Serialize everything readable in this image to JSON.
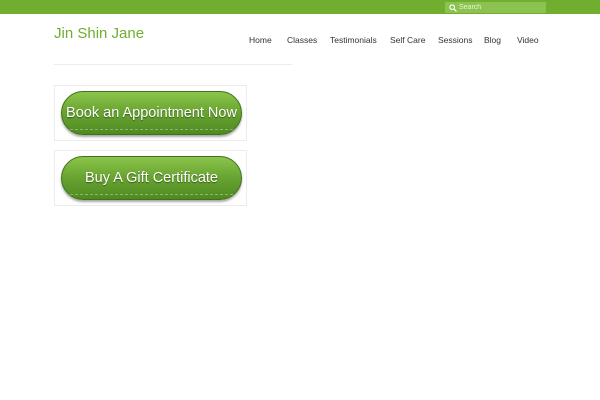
{
  "header": {
    "search": {
      "placeholder": "Search",
      "value": "",
      "icon": "search-icon"
    },
    "site_title": "Jin Shin Jane",
    "nav": [
      {
        "label": "Home"
      },
      {
        "label": "Classes"
      },
      {
        "label": "Testimonials"
      },
      {
        "label": "Self Care"
      },
      {
        "label": "Sessions"
      },
      {
        "label": "Blog"
      },
      {
        "label": "Video"
      }
    ]
  },
  "main": {
    "buttons": [
      {
        "label": "Book an Appointment Now"
      },
      {
        "label": "Buy A Gift Certificate"
      }
    ]
  },
  "colors": {
    "accent": "#6fae2e",
    "nav_text": "#333333",
    "button_green": "#6aa632"
  }
}
